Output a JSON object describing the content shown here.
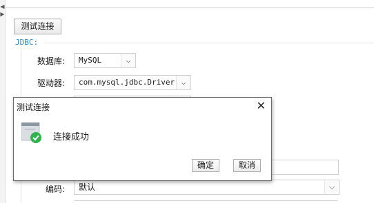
{
  "panel": {
    "test_button": "测试连接",
    "group_legend": "JDBC:",
    "fields": {
      "database_label": "数据库:",
      "database_value": "MySQL",
      "driver_label": "驱动器:",
      "driver_value": "com.mysql.jdbc.Driver",
      "encoding_label": "编码:",
      "encoding_value": "默认"
    }
  },
  "dialog": {
    "title": "测试连接",
    "close_glyph": "✕",
    "message": "连接成功",
    "ok_label": "确定",
    "cancel_label": "取消"
  },
  "icons": {
    "left_strip_up": "chevron-left-icon",
    "left_strip_down": "chevron-right-icon",
    "dropdown": "chevron-down-icon",
    "success": "success-check-icon"
  },
  "colors": {
    "legend": "#2b8ac6",
    "success": "#2fb34f"
  }
}
